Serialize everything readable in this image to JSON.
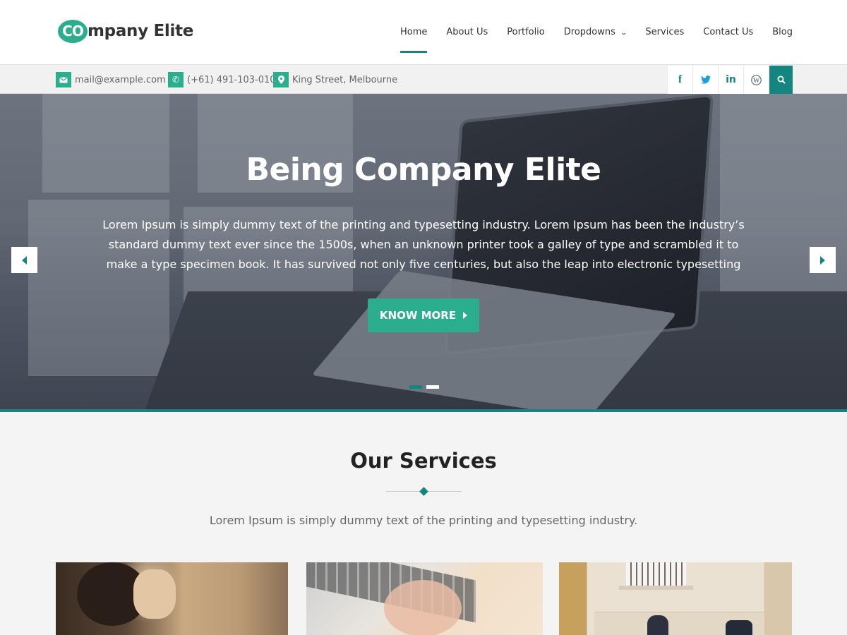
{
  "header": {
    "logo_badge": "CO",
    "logo_rest": "mpany Elite",
    "nav": [
      {
        "label": "Home",
        "active": true
      },
      {
        "label": "About Us"
      },
      {
        "label": "Portfolio"
      },
      {
        "label": "Dropdowns",
        "has_dropdown": true
      },
      {
        "label": "Services"
      },
      {
        "label": "Contact Us"
      },
      {
        "label": "Blog"
      }
    ]
  },
  "infobar": {
    "email": {
      "icon": "envelope-icon",
      "text": "mail@example.com"
    },
    "phone": {
      "icon": "phone-icon",
      "text": "(+61) 491-103-010"
    },
    "address": {
      "icon": "map-marker-icon",
      "text": "King Street, Melbourne"
    },
    "social": [
      {
        "name": "facebook",
        "glyph": "f"
      },
      {
        "name": "twitter",
        "glyph": "t"
      },
      {
        "name": "linkedin",
        "glyph": "in"
      },
      {
        "name": "wordpress",
        "glyph": "W"
      }
    ],
    "search_glyph": "⚲"
  },
  "hero": {
    "title": "Being Company Elite",
    "text": "Lorem Ipsum is simply dummy text of the printing and typesetting industry. Lorem Ipsum has been the industry’s standard dummy text ever since the 1500s, when an unknown printer took a galley of type and scrambled it to make a type specimen book. It has survived not only five centuries, but also the leap into electronic typesetting",
    "button": "KNOW MORE",
    "slides_total": 2,
    "active_slide": 1
  },
  "services": {
    "title": "Our Services",
    "subtitle": "Lorem Ipsum is simply dummy text of the printing and typesetting industry."
  },
  "colors": {
    "accent": "#15857f",
    "brand_green": "#2aae8e"
  }
}
